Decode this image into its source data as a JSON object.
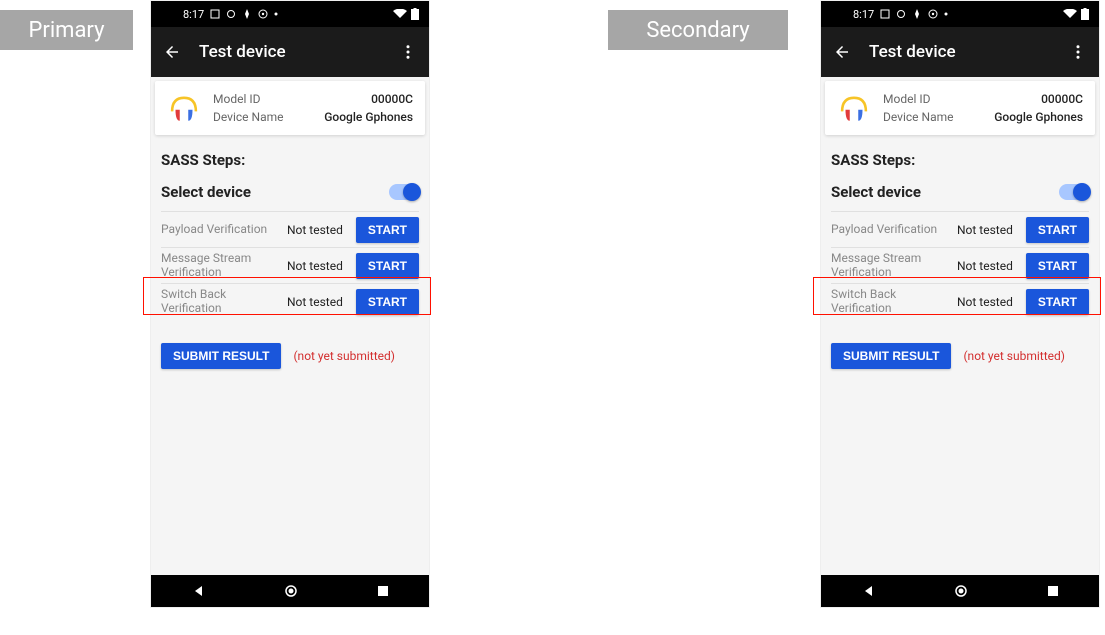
{
  "labels": {
    "primary": "Primary",
    "secondary": "Secondary"
  },
  "statusbar": {
    "time": "8:17"
  },
  "appbar": {
    "title": "Test device"
  },
  "device": {
    "model_label": "Model ID",
    "model_value": "00000C",
    "name_label": "Device Name",
    "name_value": "Google Gphones"
  },
  "main": {
    "sass_heading": "SASS Steps:",
    "select_label": "Select device",
    "tests": [
      {
        "name": "Payload Verification",
        "status": "Not tested",
        "btn": "START"
      },
      {
        "name": "Message Stream Verification",
        "status": "Not tested",
        "btn": "START"
      },
      {
        "name": "Switch Back Verification",
        "status": "Not tested",
        "btn": "START"
      }
    ],
    "submit_label": "SUBMIT RESULT",
    "submit_status": "(not yet submitted)"
  }
}
